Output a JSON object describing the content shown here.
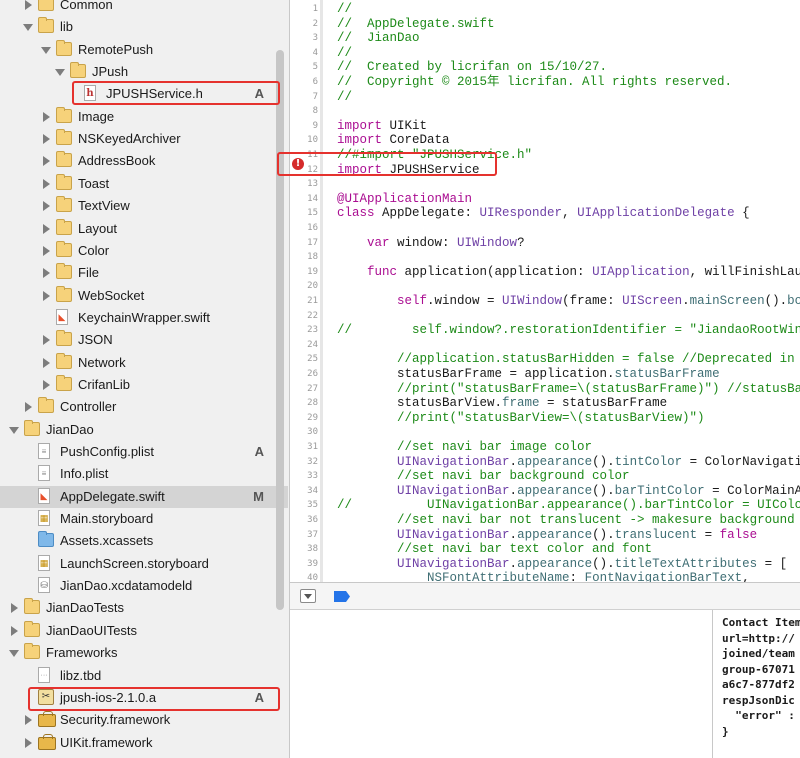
{
  "navigator": {
    "items": [
      {
        "label": "Common",
        "depth": 2,
        "icon": "folder",
        "disclosure": "closed",
        "badge": ""
      },
      {
        "label": "lib",
        "depth": 2,
        "icon": "folder",
        "disclosure": "open",
        "badge": ""
      },
      {
        "label": "RemotePush",
        "depth": 3,
        "icon": "folder",
        "disclosure": "open",
        "badge": ""
      },
      {
        "label": "JPush",
        "depth": 4,
        "icon": "folder",
        "disclosure": "open",
        "badge": ""
      },
      {
        "label": "JPUSHService.h",
        "depth": 5,
        "icon": "header-file",
        "disclosure": "none",
        "badge": "A"
      },
      {
        "label": "Image",
        "depth": 3,
        "icon": "folder",
        "disclosure": "closed",
        "badge": ""
      },
      {
        "label": "NSKeyedArchiver",
        "depth": 3,
        "icon": "folder",
        "disclosure": "closed",
        "badge": ""
      },
      {
        "label": "AddressBook",
        "depth": 3,
        "icon": "folder",
        "disclosure": "closed",
        "badge": ""
      },
      {
        "label": "Toast",
        "depth": 3,
        "icon": "folder",
        "disclosure": "closed",
        "badge": ""
      },
      {
        "label": "TextView",
        "depth": 3,
        "icon": "folder",
        "disclosure": "closed",
        "badge": ""
      },
      {
        "label": "Layout",
        "depth": 3,
        "icon": "folder",
        "disclosure": "closed",
        "badge": ""
      },
      {
        "label": "Color",
        "depth": 3,
        "icon": "folder",
        "disclosure": "closed",
        "badge": ""
      },
      {
        "label": "File",
        "depth": 3,
        "icon": "folder",
        "disclosure": "closed",
        "badge": ""
      },
      {
        "label": "WebSocket",
        "depth": 3,
        "icon": "folder",
        "disclosure": "closed",
        "badge": ""
      },
      {
        "label": "KeychainWrapper.swift",
        "depth": 3,
        "icon": "swift-file",
        "disclosure": "none",
        "badge": ""
      },
      {
        "label": "JSON",
        "depth": 3,
        "icon": "folder",
        "disclosure": "closed",
        "badge": ""
      },
      {
        "label": "Network",
        "depth": 3,
        "icon": "folder",
        "disclosure": "closed",
        "badge": ""
      },
      {
        "label": "CrifanLib",
        "depth": 3,
        "icon": "folder",
        "disclosure": "closed",
        "badge": ""
      },
      {
        "label": "Controller",
        "depth": 2,
        "icon": "folder",
        "disclosure": "closed",
        "badge": ""
      },
      {
        "label": "JianDao",
        "depth": 1,
        "icon": "folder",
        "disclosure": "open",
        "badge": ""
      },
      {
        "label": "PushConfig.plist",
        "depth": 2,
        "icon": "plist-file",
        "disclosure": "none",
        "badge": "A"
      },
      {
        "label": "Info.plist",
        "depth": 2,
        "icon": "plist-file",
        "disclosure": "none",
        "badge": ""
      },
      {
        "label": "AppDelegate.swift",
        "depth": 2,
        "icon": "swift-file",
        "disclosure": "none",
        "badge": "M"
      },
      {
        "label": "Main.storyboard",
        "depth": 2,
        "icon": "storyboard-file",
        "disclosure": "none",
        "badge": ""
      },
      {
        "label": "Assets.xcassets",
        "depth": 2,
        "icon": "blue-folder",
        "disclosure": "none",
        "badge": ""
      },
      {
        "label": "LaunchScreen.storyboard",
        "depth": 2,
        "icon": "storyboard-file",
        "disclosure": "none",
        "badge": ""
      },
      {
        "label": "JianDao.xcdatamodeld",
        "depth": 2,
        "icon": "datamodel-file",
        "disclosure": "none",
        "badge": ""
      },
      {
        "label": "JianDaoTests",
        "depth": 1,
        "icon": "folder",
        "disclosure": "closed",
        "badge": ""
      },
      {
        "label": "JianDaoUITests",
        "depth": 1,
        "icon": "folder",
        "disclosure": "closed",
        "badge": ""
      },
      {
        "label": "Frameworks",
        "depth": 1,
        "icon": "folder",
        "disclosure": "open",
        "badge": ""
      },
      {
        "label": "libz.tbd",
        "depth": 2,
        "icon": "tbd-file",
        "disclosure": "none",
        "badge": ""
      },
      {
        "label": "jpush-ios-2.1.0.a",
        "depth": 2,
        "icon": "static-lib",
        "disclosure": "none",
        "badge": "A"
      },
      {
        "label": "Security.framework",
        "depth": 2,
        "icon": "framework",
        "disclosure": "closed",
        "badge": ""
      },
      {
        "label": "UIKit.framework",
        "depth": 2,
        "icon": "framework",
        "disclosure": "closed",
        "badge": ""
      }
    ],
    "selected_label": "AppDelegate.swift"
  },
  "editor": {
    "line_numbers": [
      "1",
      "2",
      "3",
      "4",
      "5",
      "6",
      "7",
      "8",
      "9",
      "10",
      "11",
      "12",
      "13",
      "14",
      "15",
      "16",
      "17",
      "18",
      "19",
      "20",
      "21",
      "22",
      "23",
      "24",
      "25",
      "26",
      "27",
      "28",
      "29",
      "30",
      "31",
      "32",
      "33",
      "34",
      "35",
      "36",
      "37",
      "38",
      "39",
      "40"
    ],
    "error_line": "12",
    "error_glyph": "!",
    "lines": [
      [
        [
          "c",
          "//"
        ]
      ],
      [
        [
          "c",
          "//  AppDelegate.swift"
        ]
      ],
      [
        [
          "c",
          "//  JianDao"
        ]
      ],
      [
        [
          "c",
          "//"
        ]
      ],
      [
        [
          "c",
          "//  Created by licrifan on 15/10/27."
        ]
      ],
      [
        [
          "c",
          "//  Copyright © 2015年 licrifan. All rights reserved."
        ]
      ],
      [
        [
          "c",
          "//"
        ]
      ],
      [],
      [
        [
          "k",
          "import"
        ],
        [
          "p",
          " UIKit"
        ]
      ],
      [
        [
          "k",
          "import"
        ],
        [
          "p",
          " CoreData"
        ]
      ],
      [
        [
          "c",
          "//#import \"JPUSHService.h\""
        ]
      ],
      [
        [
          "k",
          "import"
        ],
        [
          "p",
          " JPUSHService"
        ]
      ],
      [],
      [
        [
          "k",
          "@UIApplicationMain"
        ]
      ],
      [
        [
          "k",
          "class"
        ],
        [
          "p",
          " AppDelegate: "
        ],
        [
          "t",
          "UIResponder"
        ],
        [
          "p",
          ", "
        ],
        [
          "t",
          "UIApplicationDelegate"
        ],
        [
          "p",
          " {"
        ]
      ],
      [],
      [
        [
          "p",
          "    "
        ],
        [
          "k",
          "var"
        ],
        [
          "p",
          " window: "
        ],
        [
          "t",
          "UIWindow"
        ],
        [
          "p",
          "?"
        ]
      ],
      [],
      [
        [
          "p",
          "    "
        ],
        [
          "k",
          "func"
        ],
        [
          "p",
          " application(application: "
        ],
        [
          "t",
          "UIApplication"
        ],
        [
          "p",
          ", willFinishLaunchingWithOptions"
        ]
      ],
      [],
      [
        [
          "p",
          "        "
        ],
        [
          "k",
          "self"
        ],
        [
          "p",
          ".window = "
        ],
        [
          "t",
          "UIWindow"
        ],
        [
          "p",
          "(frame: "
        ],
        [
          "t",
          "UIScreen"
        ],
        [
          "p",
          "."
        ],
        [
          "m",
          "mainScreen"
        ],
        [
          "p",
          "()."
        ],
        [
          "m",
          "bounds"
        ],
        [
          "p",
          ")"
        ]
      ],
      [],
      [
        [
          "c",
          "//        self.window?.restorationIdentifier = \"JiandaoRootWindow\""
        ]
      ],
      [],
      [
        [
          "c",
          "        //application.statusBarHidden = false //Deprecated in iOS 9"
        ]
      ],
      [
        [
          "p",
          "        statusBarFrame = application."
        ],
        [
          "m",
          "statusBarFrame"
        ]
      ],
      [
        [
          "c",
          "        //print(\"statusBarFrame=\\(statusBarFrame)\") //statusBarFrame"
        ]
      ],
      [
        [
          "p",
          "        statusBarView."
        ],
        [
          "m",
          "frame"
        ],
        [
          "p",
          " = statusBarFrame"
        ]
      ],
      [
        [
          "c",
          "        //print(\"statusBarView=\\(statusBarView)\")"
        ]
      ],
      [],
      [
        [
          "c",
          "        //set navi bar image color"
        ]
      ],
      [
        [
          "p",
          "        "
        ],
        [
          "t",
          "UINavigationBar"
        ],
        [
          "p",
          "."
        ],
        [
          "m",
          "appearance"
        ],
        [
          "p",
          "()."
        ],
        [
          "m",
          "tintColor"
        ],
        [
          "p",
          " = ColorNavigationBarTint"
        ]
      ],
      [
        [
          "c",
          "        //set navi bar background color"
        ]
      ],
      [
        [
          "p",
          "        "
        ],
        [
          "t",
          "UINavigationBar"
        ],
        [
          "p",
          "."
        ],
        [
          "m",
          "appearance"
        ],
        [
          "p",
          "()."
        ],
        [
          "m",
          "barTintColor"
        ],
        [
          "p",
          " = ColorMainAppBackground"
        ]
      ],
      [
        [
          "c",
          "//          UINavigationBar.appearance().barTintColor = UIColor.redColor()"
        ]
      ],
      [
        [
          "c",
          "        //set navi bar not translucent -> makesure background color"
        ]
      ],
      [
        [
          "p",
          "        "
        ],
        [
          "t",
          "UINavigationBar"
        ],
        [
          "p",
          "."
        ],
        [
          "m",
          "appearance"
        ],
        [
          "p",
          "()."
        ],
        [
          "m",
          "translucent"
        ],
        [
          "p",
          " = "
        ],
        [
          "k",
          "false"
        ]
      ],
      [
        [
          "c",
          "        //set navi bar text color and font"
        ]
      ],
      [
        [
          "p",
          "        "
        ],
        [
          "t",
          "UINavigationBar"
        ],
        [
          "p",
          "."
        ],
        [
          "m",
          "appearance"
        ],
        [
          "p",
          "()."
        ],
        [
          "m",
          "titleTextAttributes"
        ],
        [
          "p",
          " = ["
        ]
      ],
      [
        [
          "p",
          "            "
        ],
        [
          "m",
          "NSFontAttributeName"
        ],
        [
          "p",
          ": "
        ],
        [
          "m",
          "FontNavigationBarText"
        ],
        [
          "p",
          ","
        ]
      ]
    ]
  },
  "console": {
    "lines": [
      "Contact Item",
      "url=http://",
      "joined/team",
      "group-67071",
      "a6c7-877df2",
      "respJsonDic",
      "  \"error\" :",
      "}"
    ]
  }
}
